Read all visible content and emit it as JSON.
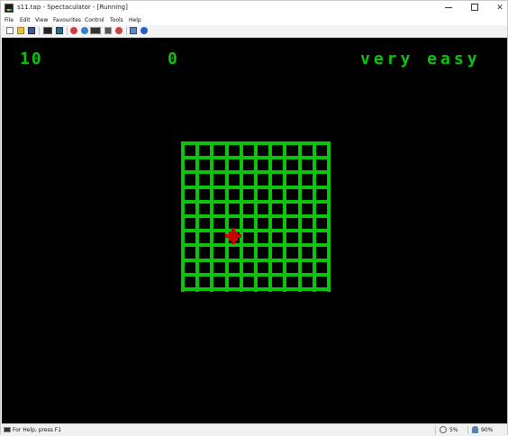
{
  "window": {
    "title": "s11.tap - Spectaculator - [Running]",
    "controls": {
      "minimize": "—",
      "maximize": "□",
      "close": "✕"
    }
  },
  "menu": {
    "items": [
      {
        "label": "File"
      },
      {
        "label": "Edit"
      },
      {
        "label": "View"
      },
      {
        "label": "Favourites"
      },
      {
        "label": "Control"
      },
      {
        "label": "Tools"
      },
      {
        "label": "Help"
      }
    ]
  },
  "toolbar": {
    "buttons": [
      {
        "name": "new-icon",
        "color": "#ffffff"
      },
      {
        "name": "open-folder-icon",
        "color": "#e8c040"
      },
      {
        "name": "save-icon",
        "color": "#3a5a9a"
      },
      {
        "name": "tape-icon",
        "color": "#222222"
      },
      {
        "name": "snapshot-icon",
        "color": "#2a6a8a"
      },
      {
        "name": "record-icon",
        "color": "#d04040"
      },
      {
        "name": "disc-icon",
        "color": "#3a7ad0"
      },
      {
        "name": "keyboard-icon",
        "color": "#333333"
      },
      {
        "name": "debugger-icon",
        "color": "#555555"
      },
      {
        "name": "search-icon",
        "color": "#777777"
      },
      {
        "name": "joystick-icon",
        "color": "#5a8ac0"
      },
      {
        "name": "help-icon",
        "color": "#2060c0"
      }
    ]
  },
  "game": {
    "lives": "10",
    "score": "0",
    "difficulty": "very easy",
    "colors": {
      "background": "#000000",
      "text": "#0bc40b",
      "grid": "#0bc40b",
      "player": "#cc0000"
    }
  },
  "status": {
    "help_text": "For Help, press F1",
    "speed": "5%",
    "volume": "90%"
  }
}
